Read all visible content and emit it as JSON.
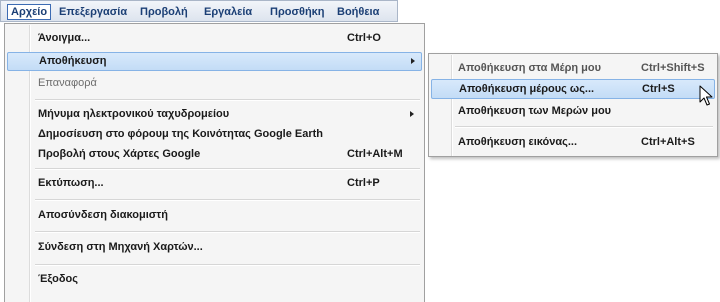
{
  "menubar": {
    "items": [
      "Αρχείο",
      "Επεξεργασία",
      "Προβολή",
      "Εργαλεία",
      "Προσθήκη",
      "Βοήθεια"
    ],
    "active": "Αρχείο"
  },
  "file_menu": {
    "items": [
      {
        "label": "Άνοιγμα...",
        "shortcut": "Ctrl+O"
      },
      {
        "label": "Αποθήκευση",
        "shortcut": "",
        "submenu": true,
        "highlighted": true
      },
      {
        "label": "Επαναφορά",
        "shortcut": "",
        "disabled": true
      },
      {
        "label": "Μήνυμα ηλεκτρονικού ταχυδρομείου",
        "shortcut": "",
        "submenu": true
      },
      {
        "label": "Δημοσίευση στο φόρουμ της Κοινότητας Google Earth",
        "shortcut": ""
      },
      {
        "label": "Προβολή στους Χάρτες Google",
        "shortcut": "Ctrl+Alt+M"
      },
      {
        "label": "Εκτύπωση...",
        "shortcut": "Ctrl+P"
      },
      {
        "label": "Αποσύνδεση διακομιστή",
        "shortcut": ""
      },
      {
        "label": "Σύνδεση στη Μηχανή Χαρτών...",
        "shortcut": ""
      },
      {
        "label": "Έξοδος",
        "shortcut": ""
      }
    ]
  },
  "save_submenu": {
    "items": [
      {
        "label": "Αποθήκευση στα Μέρη μου",
        "shortcut": "Ctrl+Shift+S"
      },
      {
        "label": "Αποθήκευση μέρους ως...",
        "shortcut": "Ctrl+S",
        "highlighted": true
      },
      {
        "label": "Αποθήκευση των Μερών μου",
        "shortcut": ""
      },
      {
        "label": "Αποθήκευση εικόνας...",
        "shortcut": "Ctrl+Alt+S"
      }
    ]
  },
  "colors": {
    "menubar_text": "#1b3f75",
    "highlight_bg": "#c3dcf6",
    "highlight_border": "#86b3e6",
    "menu_bg": "#f5f5f5"
  }
}
